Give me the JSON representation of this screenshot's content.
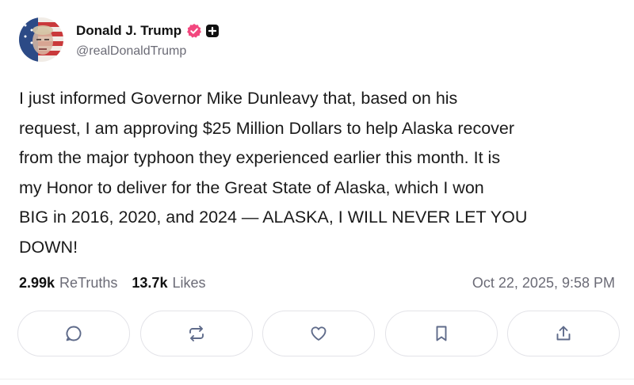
{
  "post": {
    "author": {
      "display_name": "Donald J. Trump",
      "handle": "@realDonaldTrump",
      "verified": true
    },
    "text": "I just informed Governor Mike Dunleavy that, based on his\nrequest, I am approving $25 Million Dollars to help Alaska recover\nfrom the major typhoon they experienced earlier this month. It is\nmy Honor to deliver for the Great State of Alaska, which I won\nBIG in 2016, 2020, and 2024 — ALASKA, I WILL NEVER LET YOU\nDOWN!",
    "stats": {
      "retruths_count": "2.99k",
      "retruths_label": "ReTruths",
      "likes_count": "13.7k",
      "likes_label": "Likes"
    },
    "timestamp": "Oct 22, 2025, 9:58 PM",
    "actions": [
      {
        "icon": "reply-icon"
      },
      {
        "icon": "retruth-icon"
      },
      {
        "icon": "heart-icon"
      },
      {
        "icon": "bookmark-icon"
      },
      {
        "icon": "share-icon"
      }
    ]
  },
  "colors": {
    "verified_badge": "#f2477e",
    "secondary_text": "#6b6b76",
    "button_border": "#e3e3e8",
    "icon": "#5f6b8a"
  }
}
